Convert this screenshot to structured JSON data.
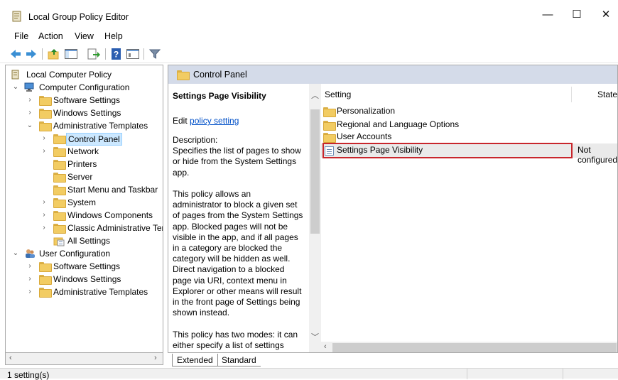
{
  "window": {
    "title": "Local Group Policy Editor",
    "minimize": "—",
    "maximize": "☐",
    "close": "✕"
  },
  "menu": [
    "File",
    "Action",
    "View",
    "Help"
  ],
  "tree": {
    "root": "Local Computer Policy",
    "computer_config": "Computer Configuration",
    "cc_software": "Software Settings",
    "cc_windows": "Windows Settings",
    "cc_admin": "Administrative Templates",
    "control_panel": "Control Panel",
    "network": "Network",
    "printers": "Printers",
    "server": "Server",
    "start_menu": "Start Menu and Taskbar",
    "system": "System",
    "windows_components": "Windows Components",
    "classic_admin": "Classic Administrative Ter",
    "all_settings": "All Settings",
    "user_config": "User Configuration",
    "uc_software": "Software Settings",
    "uc_windows": "Windows Settings",
    "uc_admin": "Administrative Templates"
  },
  "panel": {
    "header": "Control Panel",
    "desc_title": "Settings Page Visibility",
    "edit_prefix": "Edit ",
    "edit_link": "policy setting",
    "description": "Description:\nSpecifies the list of pages to show\nor hide from the System Settings\napp.\n\nThis policy allows an\nadministrator to block a given set\nof pages from the System Settings\napp. Blocked pages will not be\nvisible in the app, and if all pages\nin a category are blocked the\ncategory will be hidden as well.\nDirect navigation to a blocked\npage via URI, context menu in\nExplorer or other means will result\nin the front page of Settings being\nshown instead.\n\nThis policy has two modes: it can\neither specify a list of settings"
  },
  "list": {
    "col_setting": "Setting",
    "col_state": "State",
    "rows": [
      "Personalization",
      "Regional and Language Options",
      "User Accounts"
    ],
    "selected": "Settings Page Visibility",
    "selected_state": "Not configured"
  },
  "tabs": {
    "extended": "Extended",
    "standard": "Standard"
  },
  "status": "1 setting(s)"
}
